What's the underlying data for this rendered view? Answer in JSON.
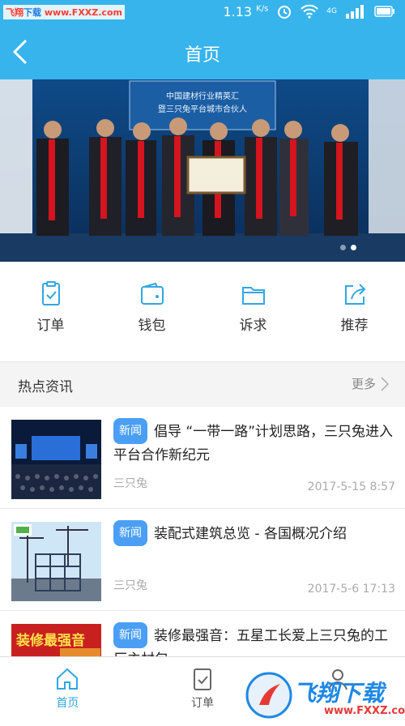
{
  "status_bar": {
    "watermark_part1": "飞翔",
    "watermark_part2": "下载",
    "watermark_url": "www.FXXZ.com",
    "speed": "1.13",
    "speed_unit": "K/s",
    "network": "4G"
  },
  "header": {
    "title": "首页",
    "back_icon": "back-arrow-icon"
  },
  "banner": {
    "screen_text_line1": "中国建材行业精英汇",
    "screen_text_line2": "暨三只兔平台城市合伙人",
    "slides_total": 2,
    "active_slide": 2
  },
  "quick_actions": [
    {
      "label": "订单",
      "icon": "order-icon"
    },
    {
      "label": "钱包",
      "icon": "wallet-icon"
    },
    {
      "label": "诉求",
      "icon": "folder-icon"
    },
    {
      "label": "推荐",
      "icon": "share-icon"
    }
  ],
  "section": {
    "title": "热点资讯",
    "more": "更多"
  },
  "news": [
    {
      "tag": "新闻",
      "title": "倡导 “一带一路”计划思路，三只兔进入平台合作新纪元",
      "source": "三只兔",
      "date": "2017-5-15 8:57"
    },
    {
      "tag": "新闻",
      "title": "装配式建筑总览 - 各国概况介绍",
      "source": "三只兔",
      "date": "2017-5-6 17:13"
    },
    {
      "tag": "新闻",
      "title": "装修最强音：五星工长爱上三只兔的工厂主材包",
      "thumb_text": "装修最强音",
      "source": "",
      "date": ""
    }
  ],
  "tabbar": [
    {
      "label": "首页",
      "icon": "home-icon",
      "active": true
    },
    {
      "label": "订单",
      "icon": "order-tab-icon",
      "active": false
    },
    {
      "label": "",
      "icon": "profile-icon",
      "active": false
    }
  ],
  "site_logo": {
    "text": "飞翔下载",
    "url": "www.FXXZ.com"
  },
  "colors": {
    "primary": "#37b4ec",
    "tag": "#4a9ff5",
    "accent_tab": "#2fa7e4"
  }
}
